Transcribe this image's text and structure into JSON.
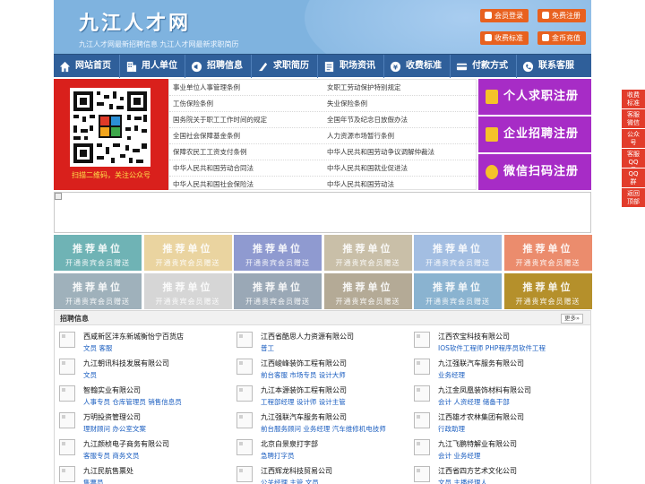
{
  "site": {
    "title": "九江人才网",
    "slogan": "九江人才网最新招聘信息   九江人才网最新求职简历"
  },
  "header_buttons": [
    {
      "label": "会员登录"
    },
    {
      "label": "免费注册"
    },
    {
      "label": "收费标准"
    },
    {
      "label": "金币充值"
    }
  ],
  "nav": [
    {
      "label": "网站首页",
      "icon": "home-icon"
    },
    {
      "label": "用人单位",
      "icon": "building-icon"
    },
    {
      "label": "招聘信息",
      "icon": "megaphone-icon"
    },
    {
      "label": "求职简历",
      "icon": "resume-icon"
    },
    {
      "label": "职场资讯",
      "icon": "news-icon"
    },
    {
      "label": "收费标准",
      "icon": "coin-icon"
    },
    {
      "label": "付款方式",
      "icon": "card-icon"
    },
    {
      "label": "联系客服",
      "icon": "phone-icon"
    }
  ],
  "qr": {
    "caption": "扫描二维码，关注公众号"
  },
  "regulations": [
    [
      "事业单位人事管理条例",
      "女职工劳动保护特别规定"
    ],
    [
      "工伤保险条例",
      "失业保险条例"
    ],
    [
      "国务院关于职工工作时间的规定",
      "全国年节及纪念日放假办法"
    ],
    [
      "全国社会保障基金条例",
      "人力资源市场暂行条例"
    ],
    [
      "保障农民工工资支付条例",
      "中华人民共和国劳动争议调解仲裁法"
    ],
    [
      "中华人民共和国劳动合同法",
      "中华人民共和国就业促进法"
    ],
    [
      "中华人民共和国社会保险法",
      "中华人民共和国劳动法"
    ]
  ],
  "cta": [
    {
      "label": "个人求职注册"
    },
    {
      "label": "企业招聘注册"
    },
    {
      "label": "微信扫码注册"
    }
  ],
  "tiles": {
    "title": "推荐单位",
    "subtitle": "开通贵宾会员赠送",
    "colors": [
      "#6fb3b5",
      "#ead4a0",
      "#8f9ad0",
      "#c9bfa8",
      "#a3bee2",
      "#eb8c6d",
      "#9fb1bb",
      "#d6d6d6",
      "#9aa8b6",
      "#b4aa96",
      "#8ab3d0",
      "#b5902b"
    ]
  },
  "jobs": {
    "title": "招聘信息",
    "more": "更多»",
    "items": [
      {
        "company": "西咸新区沣东新城衡怡宁百货店",
        "positions": "文员 客服"
      },
      {
        "company": "江西省酷思人力资源有限公司",
        "positions": "普工"
      },
      {
        "company": "江西农宝科技有限公司",
        "positions": "IOS软件工程师 PHP程序员软件工程"
      },
      {
        "company": "九江朝讯科技发展有限公司",
        "positions": "文员"
      },
      {
        "company": "江西峻峰装饰工程有限公司",
        "positions": "前台客服 市场专员 设计大师"
      },
      {
        "company": "九江强联汽车服务有限公司",
        "positions": "业务经理"
      },
      {
        "company": "智翰实业有限公司",
        "positions": "人事专员 仓库管理员 销售信息员"
      },
      {
        "company": "九江本源装饰工程有限公司",
        "positions": "工程部经理 设计师 设计主管"
      },
      {
        "company": "九江金凤凰装饰材料有限公司",
        "positions": "会计 人资经理 储备干部"
      },
      {
        "company": "万明投资管理公司",
        "positions": "理财顾问 办公室文案"
      },
      {
        "company": "九江强联汽车服务有限公司",
        "positions": "前台服务顾问 业务经理 汽车维修机电技师"
      },
      {
        "company": "江西雄才农林集团有限公司",
        "positions": "行政助理"
      },
      {
        "company": "九江颜桢电子商务有限公司",
        "positions": "客服专员 商务文员"
      },
      {
        "company": "北京白景泉打字部",
        "positions": "急聘打字员"
      },
      {
        "company": "九江飞鹏特解业有限公司",
        "positions": "会计 业务经理"
      },
      {
        "company": "九江民航售票处",
        "positions": "售票员"
      },
      {
        "company": "江西辉龙科技贸易公司",
        "positions": "公关经理 主管 文员"
      },
      {
        "company": "江西省四方艺术文化公司",
        "positions": "文员 主播经理人"
      }
    ]
  },
  "float_bar": [
    {
      "label": "收费标准"
    },
    {
      "label": "客服微信"
    },
    {
      "label": "公众号"
    },
    {
      "label": "客服QQ号"
    },
    {
      "label": "QQ群"
    },
    {
      "label": "返回顶部"
    }
  ]
}
